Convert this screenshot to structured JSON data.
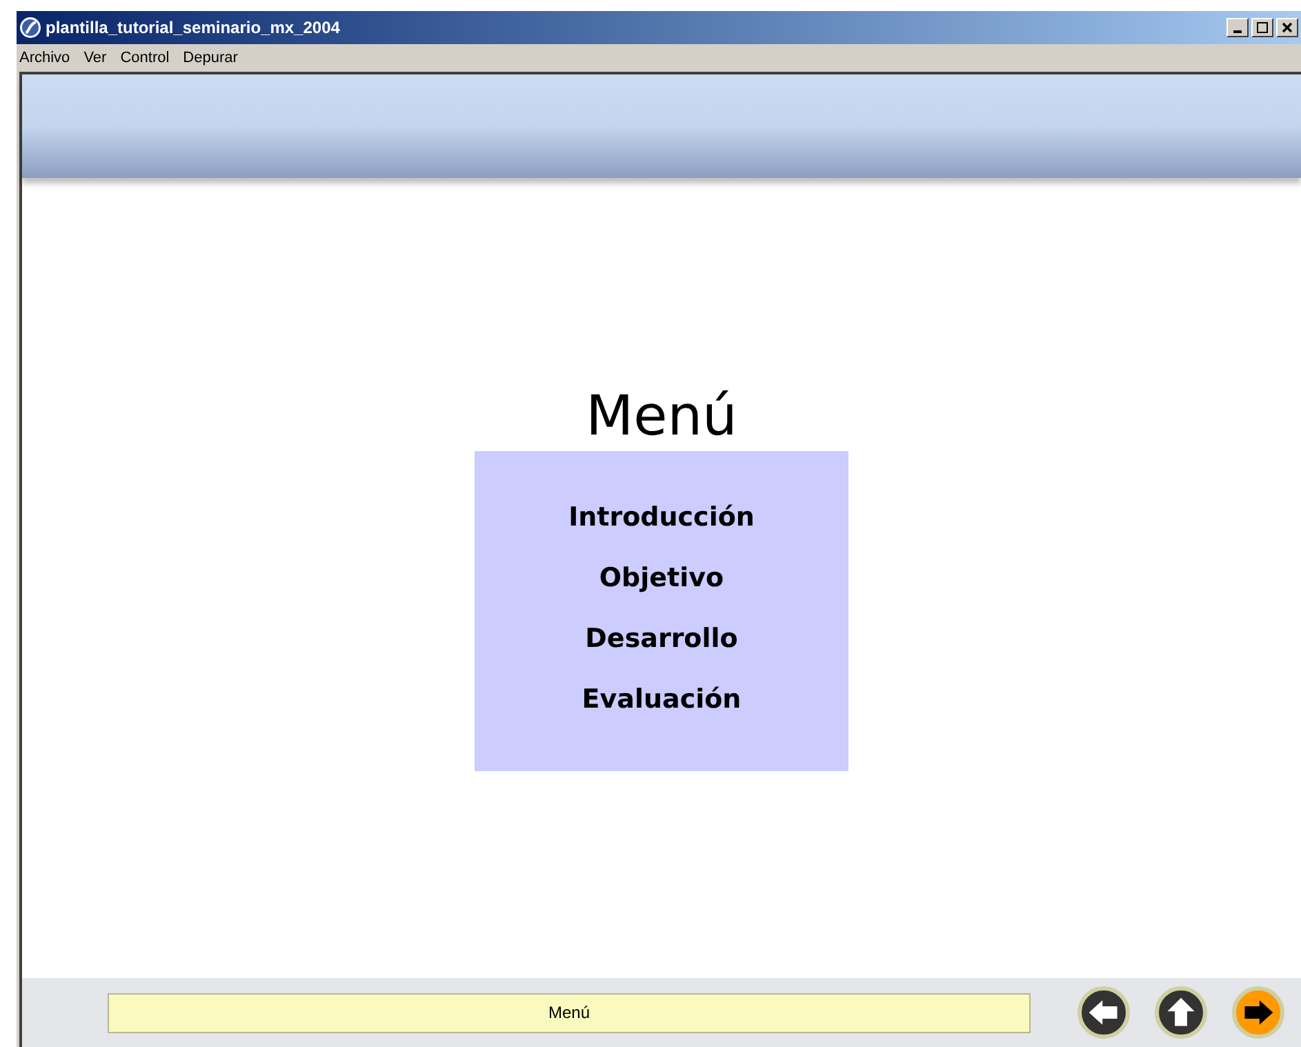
{
  "window": {
    "title": "plantilla_tutorial_seminario_mx_2004"
  },
  "menu_bar": [
    "Archivo",
    "Ver",
    "Control",
    "Depurar"
  ],
  "heading": "Menú",
  "menu_items": [
    "Introducción",
    "Objetivo",
    "Desarrollo",
    "Evaluación"
  ],
  "status_field": {
    "value": "Menú"
  },
  "nav_buttons": [
    {
      "kind": "back",
      "active": false
    },
    {
      "kind": "up",
      "active": false
    },
    {
      "kind": "forward",
      "active": true
    }
  ]
}
